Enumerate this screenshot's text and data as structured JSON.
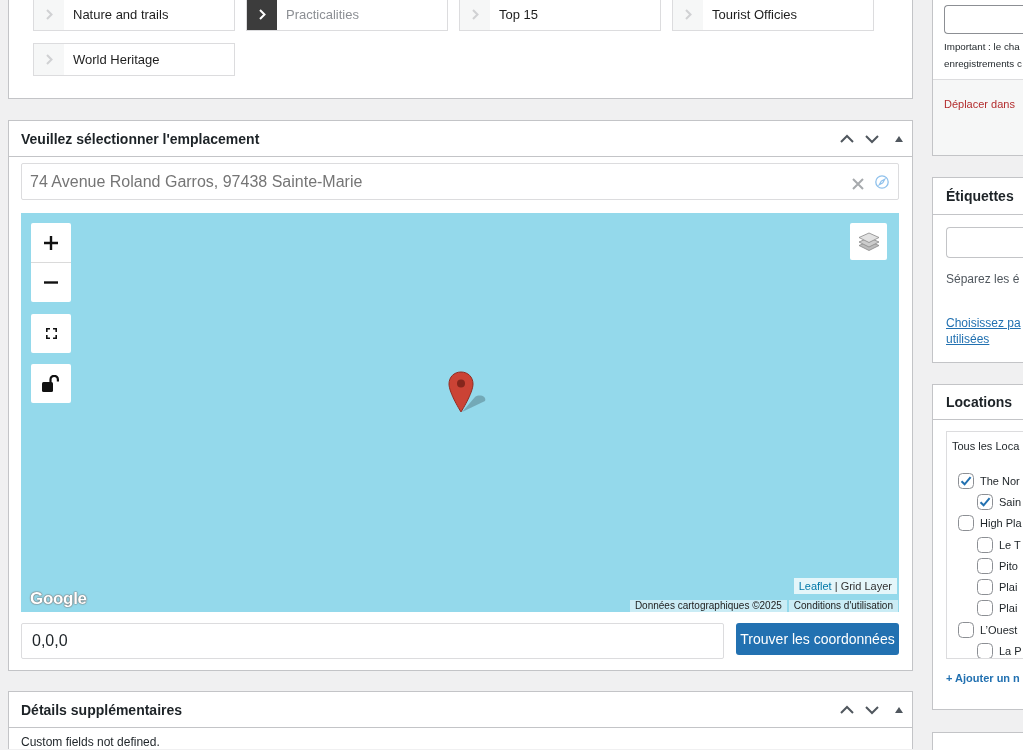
{
  "categories": [
    {
      "label": "Nature and trails",
      "selected": false
    },
    {
      "label": "Practicalities",
      "selected": true
    },
    {
      "label": "Top 15",
      "selected": false
    },
    {
      "label": "Tourist Officies",
      "selected": false
    },
    {
      "label": "World Heritage",
      "selected": false
    }
  ],
  "location_panel": {
    "title": "Veuillez sélectionner l'emplacement",
    "address": {
      "value": "74 Avenue Roland Garros, 97438 Sainte-Marie"
    },
    "map": {
      "logo": "Google",
      "attribution": {
        "link": "Leaflet",
        "text": "| Grid Layer"
      },
      "credits": [
        "Données cartographiques ©2025",
        "Conditions d'utilisation"
      ]
    },
    "coordinates": {
      "value": "0,0,0"
    },
    "find_button": "Trouver les coordonnées"
  },
  "details_panel": {
    "title": "Détails supplémentaires",
    "message": "Custom fields not defined."
  },
  "publish_panel": {
    "note_lines": [
      "Important : le cha",
      "enregistrements c"
    ],
    "trash_link": "Déplacer dans"
  },
  "tags_panel": {
    "title": "Étiquettes",
    "hint": "Séparez les é",
    "link_lines": [
      "Choisissez pa",
      "utilisées"
    ]
  },
  "locations_panel": {
    "title": "Locations",
    "tab": "Tous les Loca",
    "items": [
      {
        "label": "The Nor",
        "checked": true,
        "children": [
          {
            "label": "Sain",
            "checked": true
          }
        ]
      },
      {
        "label": "High Pla",
        "checked": false,
        "children": [
          {
            "label": "Le T",
            "checked": false
          },
          {
            "label": "Pito",
            "checked": false
          },
          {
            "label": "Plai",
            "checked": false
          },
          {
            "label": "Plai",
            "checked": false
          }
        ]
      },
      {
        "label": "L’Ouest",
        "checked": false,
        "children": [
          {
            "label": "La P",
            "checked": false
          }
        ]
      }
    ],
    "add_link": "+ Ajouter un n"
  }
}
